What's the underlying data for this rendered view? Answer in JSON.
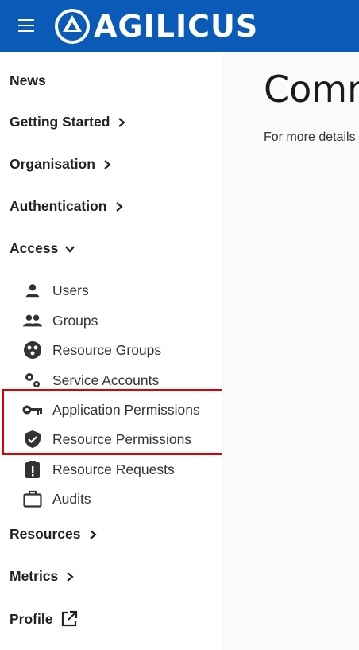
{
  "header": {
    "brand": "AGILICUS",
    "menu_icon": "hamburger-menu-icon",
    "background": "#0a5bb8"
  },
  "sidebar": {
    "top_items": [
      {
        "label": "News"
      },
      {
        "label": "Getting Started"
      },
      {
        "label": "Organisation"
      },
      {
        "label": "Authentication"
      },
      {
        "label": "Access"
      }
    ],
    "access_items": [
      {
        "label": "Users",
        "icon": "person-icon"
      },
      {
        "label": "Groups",
        "icon": "people-icon"
      },
      {
        "label": "Resource Groups",
        "icon": "resource-groups-icon"
      },
      {
        "label": "Service Accounts",
        "icon": "gears-icon"
      },
      {
        "label": "Application Permissions",
        "icon": "key-icon"
      },
      {
        "label": "Resource Permissions",
        "icon": "shield-check-icon"
      },
      {
        "label": "Resource Requests",
        "icon": "clipboard-alert-icon"
      },
      {
        "label": "Audits",
        "icon": "briefcase-icon"
      }
    ],
    "bottom_items": [
      {
        "label": "Resources"
      },
      {
        "label": "Metrics"
      },
      {
        "label": "Profile"
      }
    ],
    "highlight_color": "#e00000"
  },
  "main": {
    "title": "Comm",
    "text": "For more details"
  }
}
